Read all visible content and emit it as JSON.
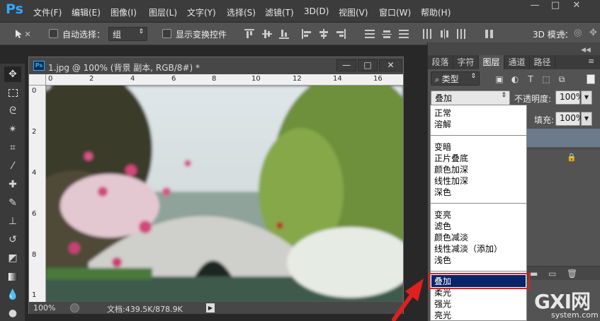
{
  "app": {
    "logo": "Ps"
  },
  "menus": [
    "文件(F)",
    "编辑(E)",
    "图像(I)",
    "图层(L)",
    "文字(Y)",
    "选择(S)",
    "滤镜(T)",
    "3D(D)",
    "视图(V)",
    "窗口(W)",
    "帮助(H)"
  ],
  "window_controls": {
    "minimize": "—",
    "restore": "□",
    "close": "✕"
  },
  "options": {
    "auto_select_label": "自动选择：",
    "auto_select_value": "组",
    "show_transform_label": "显示变换控件",
    "mode_3d_label": "3D 模式："
  },
  "document": {
    "title": "1.jpg @ 100% (背景 副本, RGB/8#) *",
    "ps_badge": "Ps",
    "zoom": "100%",
    "doc_size": "文档:439.5K/878.9K",
    "ruler_x": [
      "0",
      "2",
      "4",
      "6",
      "8",
      "10",
      "12",
      "14",
      "16"
    ],
    "ruler_y": [
      "0",
      "2",
      "4",
      "6",
      "8",
      "1"
    ],
    "min_btn": "—",
    "max_btn": "□",
    "close_btn": "✕"
  },
  "panel": {
    "tabs": [
      "段落",
      "字符",
      "图层",
      "通道",
      "路径"
    ],
    "active_tab": "图层",
    "filter_kind": "类型",
    "blend_mode": "叠加",
    "opacity_label": "不透明度:",
    "opacity_value": "100%",
    "fill_label": "填充:",
    "fill_value": "100%"
  },
  "blend_modes": {
    "groups": [
      [
        "正常",
        "溶解"
      ],
      [
        "变暗",
        "正片叠底",
        "颜色加深",
        "线性加深",
        "深色"
      ],
      [
        "变亮",
        "滤色",
        "颜色减淡",
        "线性减淡（添加）",
        "浅色"
      ],
      [
        "叠加",
        "柔光",
        "强光",
        "亮光"
      ]
    ],
    "selected": "叠加"
  },
  "watermark": {
    "brand": "GXI网",
    "domain": "system.com"
  },
  "colors": {
    "accent": "#31a8ff",
    "selection": "#0a246a",
    "highlight_box": "#e02020",
    "arrow": "#e02020"
  }
}
